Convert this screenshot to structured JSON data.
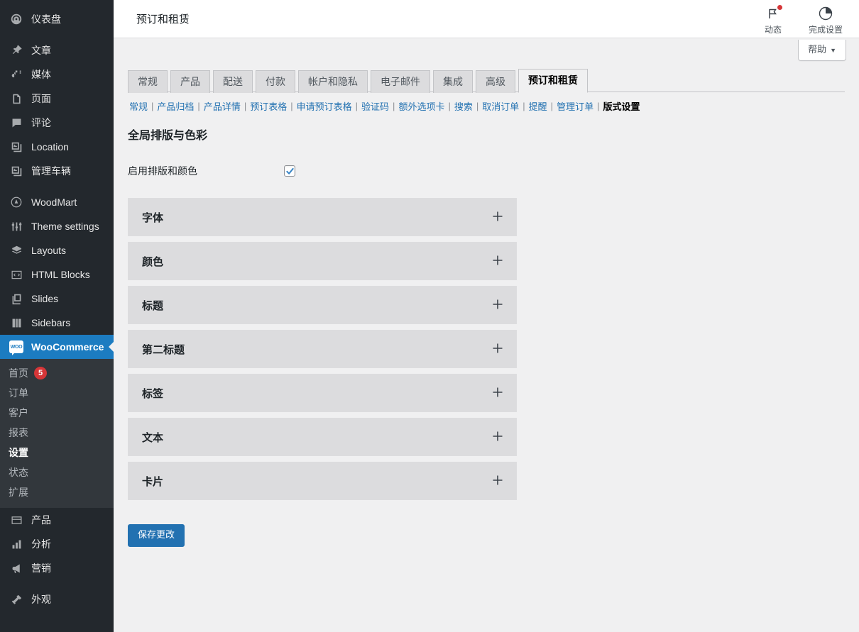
{
  "sidebar": {
    "items": [
      {
        "label": "仪表盘",
        "icon": "dashboard-icon"
      },
      {
        "label": "文章",
        "icon": "pin-icon",
        "gap_before": true
      },
      {
        "label": "媒体",
        "icon": "media-icon"
      },
      {
        "label": "页面",
        "icon": "pages-icon"
      },
      {
        "label": "评论",
        "icon": "comments-icon"
      },
      {
        "label": "Location",
        "icon": "gallery-icon"
      },
      {
        "label": "管理车辆",
        "icon": "gallery-icon"
      },
      {
        "label": "WoodMart",
        "icon": "woodmart-icon",
        "gap_before": true
      },
      {
        "label": "Theme settings",
        "icon": "sliders-icon"
      },
      {
        "label": "Layouts",
        "icon": "layers-icon"
      },
      {
        "label": "HTML Blocks",
        "icon": "code-icon"
      },
      {
        "label": "Slides",
        "icon": "slides-icon"
      },
      {
        "label": "Sidebars",
        "icon": "sidebars-icon"
      }
    ],
    "active": {
      "label": "WooCommerce",
      "icon": "woo-icon"
    },
    "submenu": [
      {
        "label": "首页",
        "count": "5"
      },
      {
        "label": "订单"
      },
      {
        "label": "客户"
      },
      {
        "label": "报表"
      },
      {
        "label": "设置",
        "current": true
      },
      {
        "label": "状态"
      },
      {
        "label": "扩展"
      }
    ],
    "items_after": [
      {
        "label": "产品",
        "icon": "product-icon"
      },
      {
        "label": "分析",
        "icon": "analytics-icon"
      },
      {
        "label": "营销",
        "icon": "megaphone-icon"
      },
      {
        "label": "外观",
        "icon": "appearance-icon",
        "gap_before": true
      }
    ]
  },
  "header": {
    "title": "预订和租赁",
    "activity": {
      "label": "动态",
      "icon": "flag-icon",
      "has_notification": true
    },
    "setup": {
      "label": "完成设置",
      "icon": "progress-circle-icon"
    }
  },
  "help": {
    "label": "帮助",
    "caret": "▼"
  },
  "tabs": [
    {
      "label": "常规"
    },
    {
      "label": "产品"
    },
    {
      "label": "配送"
    },
    {
      "label": "付款"
    },
    {
      "label": "帐户和隐私"
    },
    {
      "label": "电子邮件"
    },
    {
      "label": "集成"
    },
    {
      "label": "高级"
    },
    {
      "label": "预订和租赁",
      "active": true
    }
  ],
  "subnav": [
    {
      "label": "常规"
    },
    {
      "label": "产品归档"
    },
    {
      "label": "产品详情"
    },
    {
      "label": "预订表格"
    },
    {
      "label": "申请预订表格"
    },
    {
      "label": "验证码"
    },
    {
      "label": "额外选项卡"
    },
    {
      "label": "搜索"
    },
    {
      "label": "取消订单"
    },
    {
      "label": "提醒"
    },
    {
      "label": "管理订单"
    },
    {
      "label": "版式设置",
      "current": true
    }
  ],
  "section": {
    "title": "全局排版与色彩",
    "enable_row": {
      "label": "启用排版和颜色",
      "checked": true
    }
  },
  "accordion": [
    {
      "label": "字体"
    },
    {
      "label": "颜色"
    },
    {
      "label": "标题"
    },
    {
      "label": "第二标题"
    },
    {
      "label": "标签"
    },
    {
      "label": "文本"
    },
    {
      "label": "卡片"
    }
  ],
  "save_button": {
    "label": "保存更改"
  },
  "colors": {
    "sidebar_bg": "#23282d",
    "submenu_bg": "#32373c",
    "accent_blue": "#2271b1",
    "highlight_blue": "#1c7cc1",
    "content_bg": "#f0f0f1",
    "panel_bg": "#dcdcde",
    "badge_red": "#d63638"
  }
}
